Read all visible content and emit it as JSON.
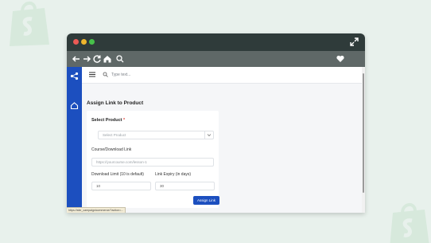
{
  "window": {
    "url_status": "https://site_campaignicommerce/?action=..."
  },
  "topbar": {
    "search_placeholder": "Type text..."
  },
  "page": {
    "title": "Assign Link to Product"
  },
  "form": {
    "product_label": "Select Product",
    "required_mark": "*",
    "product_placeholder": "Select Product",
    "course_link_label": "Course/Download Link",
    "course_link_placeholder": "https://yourcourse.com/lesson-1",
    "download_limit_label": "Download Limit (10 is default)",
    "download_limit_value": "10",
    "link_expiry_label": "Link Expiry (in days)",
    "link_expiry_value": "30",
    "assign_button_label": "Assign Link"
  },
  "colors": {
    "accent": "#1c4fbf",
    "titlebar": "#2f3b3a",
    "navbar": "#5f6867",
    "background": "#e8f1ec"
  },
  "icons": {
    "nav": [
      "back-arrow-icon",
      "forward-arrow-icon",
      "reload-icon",
      "home-icon",
      "search-icon",
      "heart-icon"
    ],
    "sidebar": [
      "app-logo-icon",
      "dashboard-home-icon"
    ]
  }
}
